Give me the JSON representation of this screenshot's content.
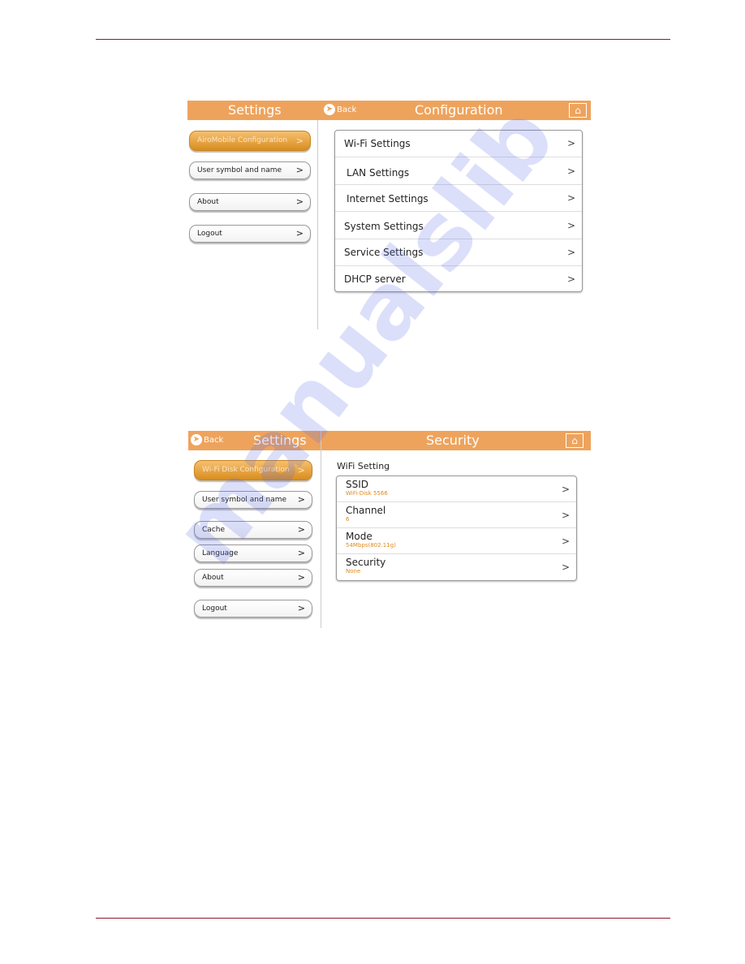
{
  "screen1": {
    "left_title": "Settings",
    "back": "Back",
    "title": "Configuration",
    "sidebar": [
      "AiroMobile Configuration",
      "User symbol and name",
      "About",
      "Logout"
    ],
    "items": [
      "Wi-Fi Settings",
      "LAN Settings",
      "Internet Settings",
      "System Settings",
      "Service Settings",
      "DHCP server"
    ]
  },
  "screen2": {
    "back": "Back",
    "left_title": "Settings",
    "title": "Security",
    "sidebar": [
      "Wi-Fi Disk Configuration",
      "User symbol and name",
      "Cache",
      "Language",
      "About",
      "Logout"
    ],
    "section": "WiFi Setting",
    "items": [
      {
        "label": "SSID",
        "value": "WiFi-Disk 5566"
      },
      {
        "label": "Channel",
        "value": "6"
      },
      {
        "label": "Mode",
        "value": "54Mbps(802.11g)"
      },
      {
        "label": "Security",
        "value": "None"
      }
    ]
  },
  "watermark": "manualslib",
  "colors": {
    "header": "#eea35c",
    "rule": "#8b1a2b",
    "value": "#e08a20"
  }
}
